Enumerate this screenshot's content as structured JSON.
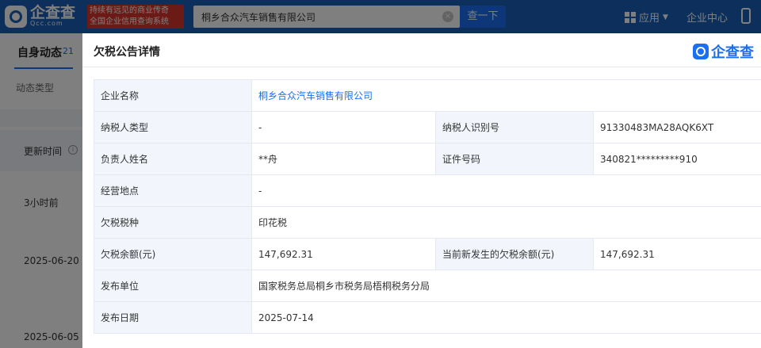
{
  "header": {
    "logo_text": "企查查",
    "logo_sub": "Qcc.com",
    "slogan_line1": "持续有远见的商业传奇",
    "slogan_line2": "全国企业信用查询系统",
    "search_value": "桐乡合众汽车销售有限公司",
    "search_button": "查一下",
    "apps_label": "应用",
    "enterprise_center": "企业中心"
  },
  "background_page": {
    "tab_label": "自身动态",
    "tab_count": "21",
    "filter_label": "动态类型",
    "column_header": "更新时间",
    "rows": [
      "3小时前",
      "2025-06-20",
      "2025-06-05"
    ]
  },
  "modal": {
    "title": "欠税公告详情",
    "brand": "企查查",
    "fields": {
      "company_name_label": "企业名称",
      "company_name": "桐乡合众汽车销售有限公司",
      "taxpayer_type_label": "纳税人类型",
      "taxpayer_type": "-",
      "taxpayer_id_label": "纳税人识别号",
      "taxpayer_id": "91330483MA28AQK6XT",
      "person_label": "负责人姓名",
      "person": "**舟",
      "cert_label": "证件号码",
      "cert": "340821*********910",
      "address_label": "经营地点",
      "address": "-",
      "tax_type_label": "欠税税种",
      "tax_type": "印花税",
      "balance_label": "欠税余额(元)",
      "balance": "147,692.31",
      "new_balance_label": "当前新发生的欠税余额(元)",
      "new_balance": "147,692.31",
      "publisher_label": "发布单位",
      "publisher": "国家税务总局桐乡市税务局梧桐税务分局",
      "publish_date_label": "发布日期",
      "publish_date": "2025-07-14"
    }
  },
  "colors": {
    "brand_blue": "#1a6ff0",
    "label_bg": "#f2f6fc",
    "border": "#e4e9f2"
  }
}
